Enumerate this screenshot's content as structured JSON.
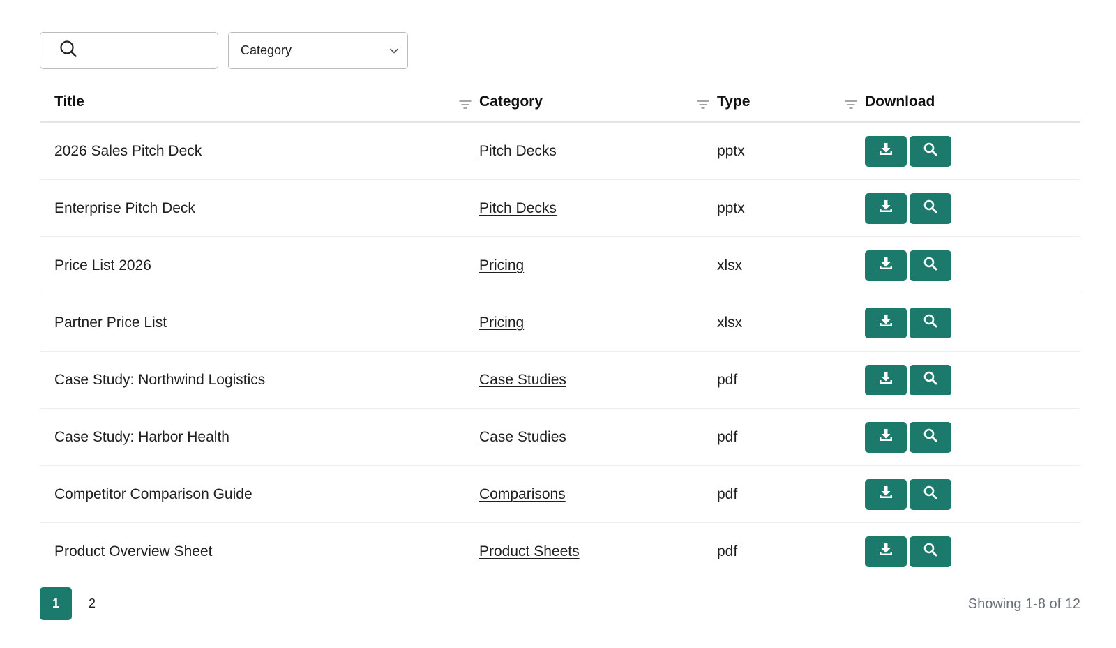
{
  "filters": {
    "search_placeholder": "",
    "category_select_label": "Category"
  },
  "table": {
    "headers": {
      "title": "Title",
      "category": "Category",
      "type": "Type",
      "download": "Download"
    },
    "rows": [
      {
        "title": "2026 Sales Pitch Deck",
        "category": "Pitch Decks",
        "type": "pptx"
      },
      {
        "title": "Enterprise Pitch Deck",
        "category": "Pitch Decks",
        "type": "pptx"
      },
      {
        "title": "Price List 2026",
        "category": "Pricing",
        "type": "xlsx"
      },
      {
        "title": "Partner Price List",
        "category": "Pricing",
        "type": "xlsx"
      },
      {
        "title": "Case Study: Northwind Logistics",
        "category": "Case Studies",
        "type": "pdf"
      },
      {
        "title": "Case Study: Harbor Health",
        "category": "Case Studies",
        "type": "pdf"
      },
      {
        "title": "Competitor Comparison Guide",
        "category": "Comparisons",
        "type": "pdf"
      },
      {
        "title": "Product Overview Sheet",
        "category": "Product Sheets",
        "type": "pdf"
      }
    ],
    "row_actions": {
      "download_icon": "download-icon",
      "preview_icon": "magnifier-icon"
    }
  },
  "pagination": {
    "pages": [
      "1",
      "2"
    ],
    "current": "1",
    "summary": "Showing 1-8 of 12"
  },
  "colors": {
    "accent": "#1b7a6c",
    "border": "#b9bcc0",
    "muted_text": "#6b7178"
  }
}
